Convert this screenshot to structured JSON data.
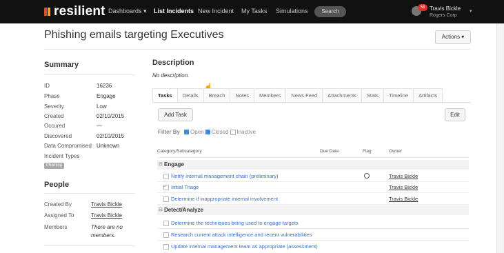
{
  "nav": {
    "brand": "resilient",
    "items": [
      {
        "label": "Dashboards ▾"
      },
      {
        "label": "List Incidents"
      },
      {
        "label": "New Incident"
      },
      {
        "label": "My Tasks"
      },
      {
        "label": "Simulations"
      }
    ],
    "search": "Search",
    "notifications": "58",
    "user_name": "Travis Bickle",
    "user_org": "Rogers Corp",
    "colors": {
      "bar": "#111111",
      "brand_red": "#e24c2a",
      "brand_orange": "#f0a030",
      "badge": "#d9342b"
    }
  },
  "incident": {
    "title": "Phishing emails targeting Executives",
    "actions_label": "Actions ▾"
  },
  "summary": {
    "heading": "Summary",
    "fields": [
      {
        "key": "ID",
        "value": "16236"
      },
      {
        "key": "Phase",
        "value": "Engage"
      },
      {
        "key": "Severity",
        "value": "Low"
      },
      {
        "key": "Created",
        "value": "02/10/2015"
      },
      {
        "key": "Occured",
        "value": "—"
      },
      {
        "key": "Discovered",
        "value": "02/10/2015"
      },
      {
        "key": "Data Compromised",
        "value": "Unknown"
      },
      {
        "key": "Incident Types",
        "value": ""
      }
    ],
    "tag": "Phishing"
  },
  "people": {
    "heading": "People",
    "created_by_label": "Created By",
    "created_by": "Travis Bickle",
    "assigned_to_label": "Assigned To",
    "assigned_to": "Travis Bickle",
    "members_label": "Members",
    "members_line1": "There are no",
    "members_line2": "members."
  },
  "description": {
    "heading": "Description",
    "text": "No description."
  },
  "tabs": [
    "Tasks",
    "Details",
    "Breach",
    "Notes",
    "Members",
    "News Feed",
    "Attachments",
    "Stats",
    "Timeline",
    "Artifacts"
  ],
  "tasks": {
    "add_label": "Add Task",
    "edit_label": "Edit",
    "filter_label": "Filter By",
    "filter_open": "Open",
    "filter_closed": "Closed",
    "filter_inactive": "Inactive",
    "columns": {
      "category": "Category/Subcategory",
      "due": "Due Date",
      "flag": "Flag",
      "owner": "Owner"
    },
    "groups": [
      {
        "name": "Engage",
        "tasks": [
          {
            "name": "Notify internal management chain (preliminary)",
            "owner": "Travis Bickle",
            "flag": true,
            "done": false
          },
          {
            "name": "Initial Triage",
            "owner": "Travis Bickle",
            "flag": false,
            "done": true
          },
          {
            "name": "Determine if inappropriate internal involvement",
            "owner": "Travis Bickle",
            "flag": false,
            "done": false
          }
        ]
      },
      {
        "name": "Detect/Analyze",
        "tasks": [
          {
            "name": "Determine the techniques being used to engage targets",
            "owner": "",
            "flag": false,
            "done": false
          },
          {
            "name": "Research current attack intelligence and recent vulnerabilities",
            "owner": "",
            "flag": false,
            "done": false
          },
          {
            "name": "Update internal management team as appropriate (assessment)",
            "owner": "",
            "flag": false,
            "done": false
          }
        ]
      }
    ]
  }
}
